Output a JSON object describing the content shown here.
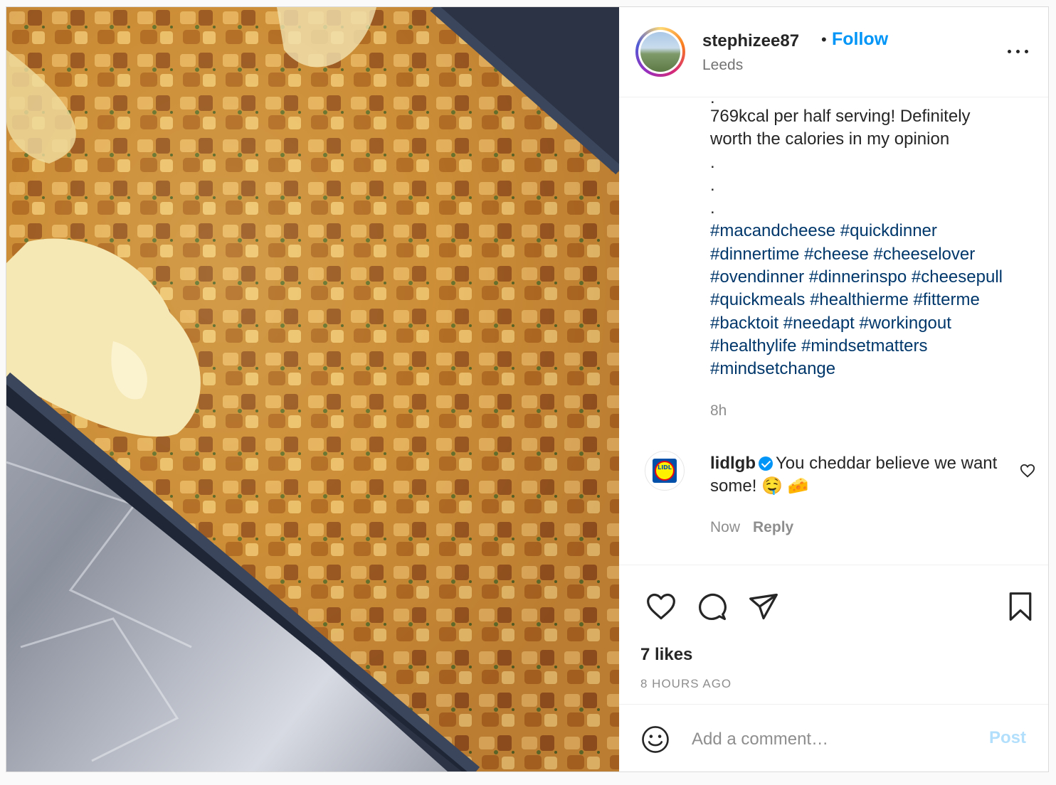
{
  "post": {
    "username": "stephizee87",
    "separator": "•",
    "follow_label": "Follow",
    "location": "Leeds",
    "more_icon": "more-horizontal-icon",
    "image_alt": "Baked mac and cheese with golden toasted bread crumbs in a foil tray"
  },
  "caption": {
    "lines": [
      ".",
      "769kcal per half serving! Definitely",
      "worth the calories in my opinion",
      ".",
      ".",
      "."
    ],
    "hashtag_lines": [
      "#macandcheese #quickdinner",
      "#dinnertime #cheese #cheeselover",
      "#ovendinner #dinnerinspo #cheesepull",
      "#quickmeals #healthierme #fitterme",
      "#backtoit #needapt #workingout",
      "#healthylife #mindsetmatters",
      "#mindsetchange"
    ],
    "time": "8h"
  },
  "comment": {
    "username": "lidlgb",
    "text": "You cheddar believe we want some! 🤤 🧀",
    "time": "Now",
    "reply_label": "Reply",
    "avatar_text": "LIDL"
  },
  "actions": {
    "likes": "7 likes",
    "posted_ago": "8 HOURS AGO"
  },
  "add_comment": {
    "placeholder": "Add a comment…",
    "post_label": "Post"
  },
  "colors": {
    "follow": "#0095f6",
    "hashtag": "#00376b",
    "muted": "#8e8e8e",
    "post_disabled": "#b2dffc"
  }
}
